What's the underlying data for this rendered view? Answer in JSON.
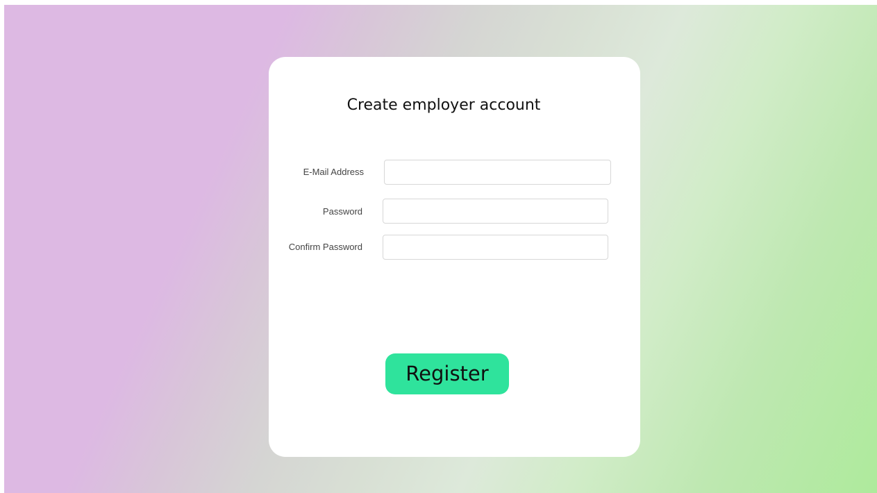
{
  "page": {
    "colors": {
      "background_start": "#ddb9e3",
      "background_middle": "#dde9da",
      "background_end": "#aeea9c",
      "card": "#ffffff",
      "button": "#2fe39c",
      "input_border": "#d7d7d7"
    }
  },
  "form": {
    "title": "Create employer account",
    "fields": [
      {
        "label": "E-Mail Address",
        "value": "",
        "placeholder": ""
      },
      {
        "label": "Password",
        "value": "",
        "placeholder": ""
      },
      {
        "label": "Confirm Password",
        "value": "",
        "placeholder": ""
      }
    ],
    "submit_label": "Register"
  }
}
